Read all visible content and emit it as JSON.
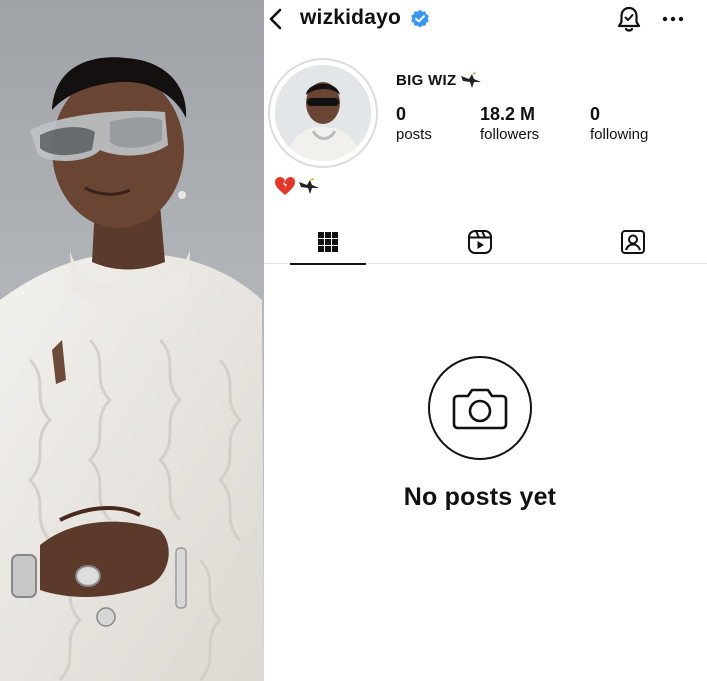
{
  "profile": {
    "username": "wizkidayo",
    "display_name": "BIG WIZ",
    "bio_emoji": "💔",
    "verified_color": "#3897f0"
  },
  "stats": [
    {
      "value": "0",
      "label": "posts"
    },
    {
      "value": "18.2 M",
      "label": "followers"
    },
    {
      "value": "0",
      "label": "following"
    }
  ],
  "tabs": [
    {
      "icon": "grid-icon",
      "active": true
    },
    {
      "icon": "reels-icon",
      "active": false
    },
    {
      "icon": "tagged-icon",
      "active": false
    }
  ],
  "empty_state": {
    "icon": "camera-icon",
    "text": "No posts yet"
  },
  "icons": {
    "back": "chevron-left-icon",
    "notifications": "bell-icon",
    "more": "more-icon"
  }
}
